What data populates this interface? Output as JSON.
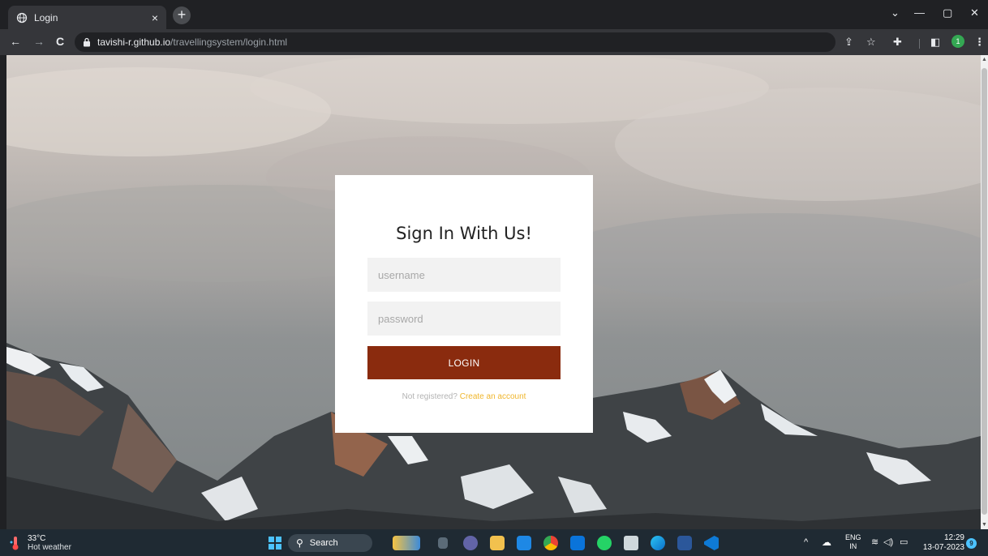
{
  "browser": {
    "tab_title": "Login",
    "tab_close": "×",
    "new_tab": "+",
    "url_host": "tavishi-r.github.io",
    "url_path": "/travellingsystem/login.html",
    "profile_initial": "1",
    "window_controls": {
      "minimize": "—",
      "maximize": "▢",
      "close": "✕",
      "tab_search": "⌄"
    },
    "nav": {
      "back": "←",
      "forward": "→",
      "reload": "C"
    }
  },
  "login": {
    "heading": "Sign In With Us!",
    "username_placeholder": "username",
    "password_placeholder": "password",
    "button_label": "LOGIN",
    "not_registered": "Not registered?",
    "create_account": "Create an account"
  },
  "taskbar": {
    "temperature": "33°C",
    "weather": "Hot weather",
    "search_label": "Search",
    "language_top": "ENG",
    "language_bottom": "IN",
    "time": "12:29",
    "date": "13-07-2023",
    "notifications": "9"
  },
  "colors": {
    "login_button": "#8a2b0e",
    "link": "#f0b62c",
    "taskbar": "#1f2a33"
  }
}
